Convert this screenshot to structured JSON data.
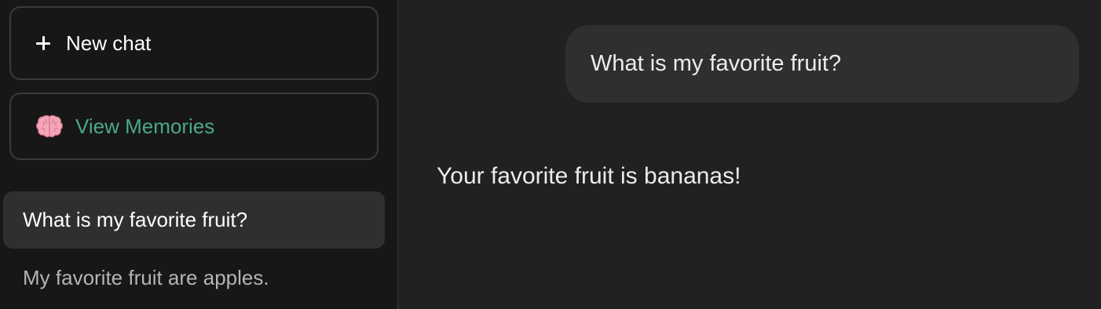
{
  "sidebar": {
    "new_chat_label": "New chat",
    "view_memories_label": "View Memories",
    "history": [
      {
        "title": "What is my favorite fruit?",
        "active": true
      },
      {
        "title": "My favorite fruit are apples.",
        "active": false
      }
    ]
  },
  "chat": {
    "messages": [
      {
        "role": "user",
        "text": "What is my favorite fruit?"
      },
      {
        "role": "assistant",
        "text": "Your favorite fruit is bananas!"
      }
    ]
  },
  "icons": {
    "new_chat": "plus-icon",
    "view_memories": "brain-icon"
  },
  "colors": {
    "sidebar_bg": "#171717",
    "main_bg": "#212121",
    "active_item_bg": "#2f2f2f",
    "memories_accent": "#4aa986"
  }
}
